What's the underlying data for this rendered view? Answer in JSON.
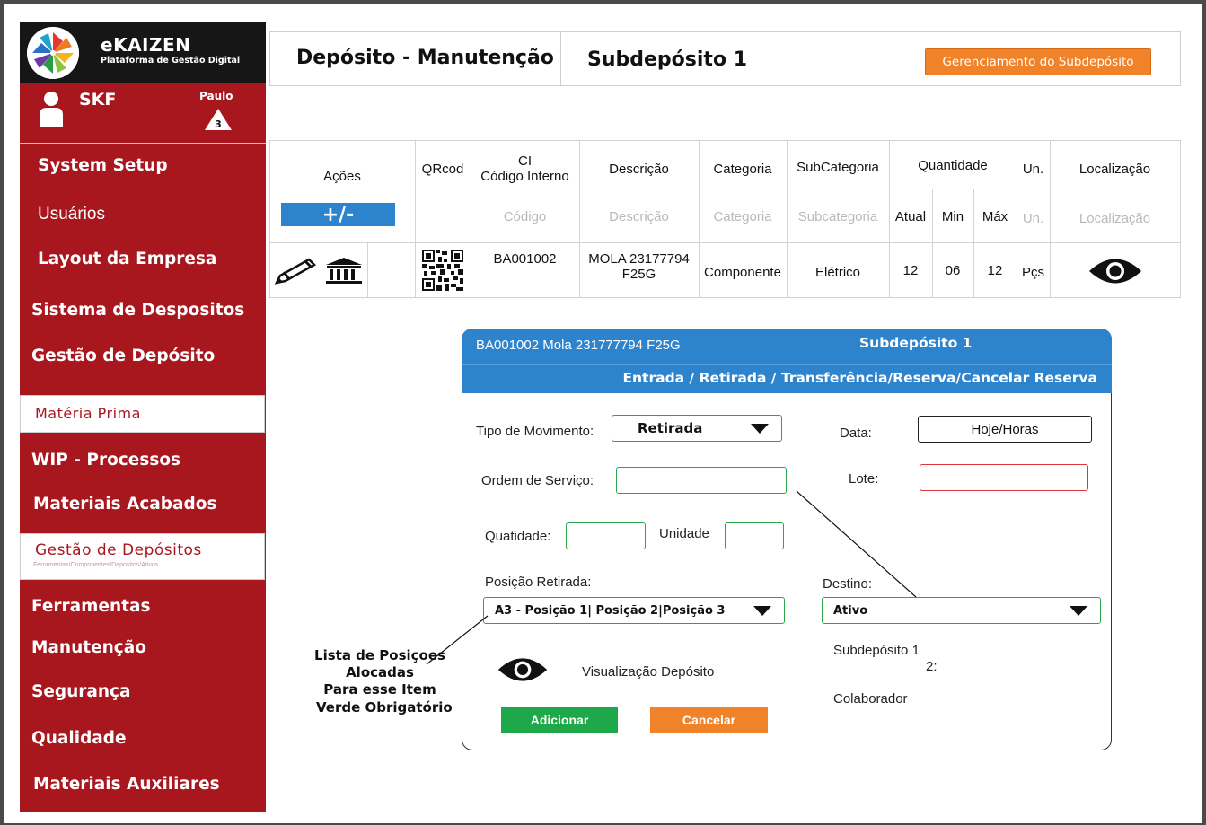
{
  "brand": {
    "name": "eKAIZEN",
    "tagline": "Plataforma de Gestão Digital"
  },
  "user": {
    "company": "SKF",
    "name": "Paulo",
    "level": "3"
  },
  "sidebar": {
    "items": [
      {
        "label": "System Setup"
      },
      {
        "label": "Usuários"
      },
      {
        "label": "Layout da Empresa"
      },
      {
        "label": "Sistema de Despositos"
      },
      {
        "label": "Gestão de Depósito"
      },
      {
        "label": "Matéria Prima"
      },
      {
        "label": "WIP - Processos"
      },
      {
        "label": "Materiais Acabados"
      },
      {
        "label": "Gestão de Depósitos",
        "sub": "Ferramentas/Componentes/Depositos/Ativos"
      },
      {
        "label": "Ferramentas"
      },
      {
        "label": "Manutenção"
      },
      {
        "label": "Segurança"
      },
      {
        "label": "Qualidade"
      },
      {
        "label": "Materiais Auxiliares"
      }
    ]
  },
  "header": {
    "title": "Depósito - Manutenção",
    "subtitle": "Subdepósito 1",
    "manage_button": "Gerenciamento do Subdepósito"
  },
  "table": {
    "headers": {
      "acoes": "Ações",
      "qrcod": "QRcod",
      "ci_line1": "CI",
      "ci_line2": "Código Interno",
      "descricao": "Descrição",
      "categoria": "Categoria",
      "subcategoria": "SubCategoria",
      "quantidade": "Quantidade",
      "un": "Un.",
      "localizacao": "Localização",
      "atual": "Atual",
      "min": "Min",
      "max": "Máx"
    },
    "add_remove_button": "+/-",
    "filters": {
      "codigo": "Código",
      "descricao": "Descrição",
      "categoria": "Categoria",
      "subcategoria": "Subcategoria",
      "un": "Un.",
      "localizacao": "Localização"
    },
    "row": {
      "codigo": "BA001002",
      "descricao_line1": "MOLA 23177794",
      "descricao_line2": "F25G",
      "categoria": "Componente",
      "subcategoria": "Elétrico",
      "atual": "12",
      "min": "06",
      "max": "12",
      "un": "Pçs"
    }
  },
  "modal": {
    "item_title": "BA001002 Mola 231777794 F25G",
    "subdeposit": "Subdepósito 1",
    "operations": "Entrada / Retirada / Transferência/Reserva/Cancelar Reserva",
    "tipo_label": "Tipo de Movimento:",
    "tipo_value": "Retirada",
    "data_label": "Data:",
    "data_value": "Hoje/Horas",
    "ordem_label": "Ordem de Serviço:",
    "lote_label": "Lote:",
    "quantidade_label": "Quatidade:",
    "unidade_label": "Unidade",
    "posicao_label": "Posição Retirada:",
    "posicao_value": "A3 - Posição 1| Posição 2|Posição 3",
    "destino_label": "Destino:",
    "destino_value": "Ativo",
    "subdep_line1": "Subdepósito 1",
    "subdep_line2": "2:",
    "colaborador": "Colaborador",
    "visualizacao": "Visualização Depósito",
    "add_button": "Adicionar",
    "cancel_button": "Cancelar"
  },
  "annotations": {
    "lista_line1": "Lista de Posiçoes Alocadas",
    "lista_line2": "Para esse Item",
    "verde": "Verde Obrigatório"
  },
  "colors": {
    "sidebar": "#a8161e",
    "accent_blue": "#2e83cd",
    "accent_orange": "#f0832a",
    "required_green": "#2aa54c",
    "alert_red": "#e0353d"
  }
}
